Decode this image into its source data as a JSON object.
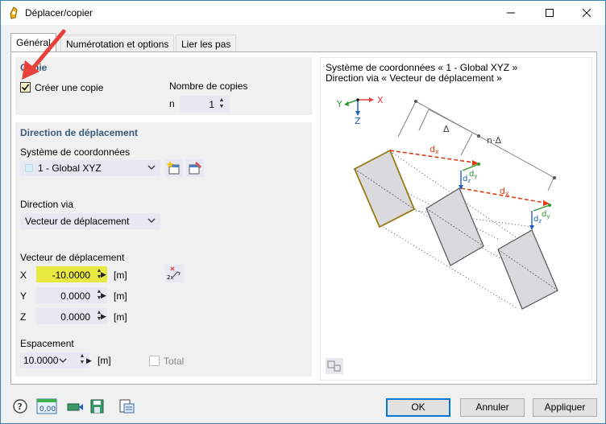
{
  "window": {
    "title": "Déplacer/copier"
  },
  "tabs": [
    {
      "label": "Général",
      "active": true
    },
    {
      "label": "Numérotation et options",
      "active": false
    },
    {
      "label": "Lier les pas",
      "active": false
    }
  ],
  "copy_group": {
    "title": "Copie",
    "create_copy_label": "Créer une copie",
    "create_copy_checked": true,
    "num_copies_label": "Nombre de copies",
    "n_label": "n",
    "n_value": "1"
  },
  "direction_group": {
    "title": "Direction de déplacement",
    "coord_system_label": "Système de coordonnées",
    "coord_system_value": "1 - Global XYZ",
    "direction_via_label": "Direction via",
    "direction_via_value": "Vecteur de déplacement",
    "vector_label": "Vecteur de déplacement",
    "x_label": "X",
    "x_value": "-10.0000",
    "y_label": "Y",
    "y_value": "0.0000",
    "z_label": "Z",
    "z_value": "0.0000",
    "unit": "[m]",
    "spacing_label": "Espacement",
    "spacing_value": "10.0000",
    "spacing_unit": "[m]",
    "total_label": "Total",
    "total_checked": false
  },
  "diagram": {
    "line1": "Système de coordonnées « 1 - Global XYZ »",
    "line2": "Direction via « Vecteur de déplacement »",
    "axis_y": "Y",
    "axis_x": "X",
    "axis_z": "Z",
    "delta": "Δ",
    "n_delta": "n·Δ",
    "dx": "d",
    "dy": "d",
    "dz": "d",
    "sub_x": "x",
    "sub_y": "y",
    "sub_z": "z"
  },
  "buttons": {
    "ok": "OK",
    "cancel": "Annuler",
    "apply": "Appliquer"
  },
  "colors": {
    "accent_yellow": "#e8e840",
    "title_blue": "#3d5b77",
    "arrow_red": "#e8413c",
    "dx_red": "#e03c14",
    "dy_green": "#2c9a2c",
    "dz_blue": "#1f5fbf",
    "highlight_edge": "#9a7a10"
  },
  "bottom_value_icon": "0,00"
}
